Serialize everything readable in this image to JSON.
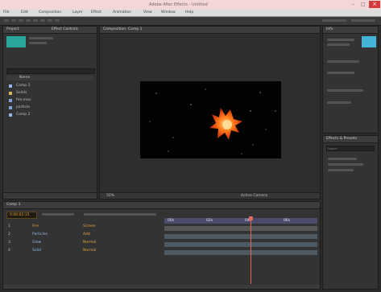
{
  "window": {
    "title": "Adobe After Effects - Untitled",
    "titlebar_color": "#f3d7d7"
  },
  "menu": [
    "File",
    "Edit",
    "Composition",
    "Layer",
    "Effect",
    "Animation",
    "View",
    "Window",
    "Help"
  ],
  "project": {
    "tab_label": "Project",
    "effects_tab_label": "Effect Controls",
    "thumbnail_color": "#2aa79a",
    "list_header": "Name",
    "items": [
      {
        "name": "Comp 1",
        "icon_color": "#8fb9e6"
      },
      {
        "name": "Solids",
        "icon_color": "#d7b35a"
      },
      {
        "name": "fire.mov",
        "icon_color": "#79a7d7"
      },
      {
        "name": "particle",
        "icon_color": "#79a7d7"
      },
      {
        "name": "Comp 2",
        "icon_color": "#8fb9e6"
      }
    ]
  },
  "composition": {
    "tab_label": "Composition: Comp 1",
    "zoom": "50%",
    "bottom_bar_label": "Active Camera"
  },
  "right_panel": {
    "top_tab": "Info",
    "info_color": "#44b3d8",
    "effects_tab": "Effects & Presets",
    "search_placeholder": "Search"
  },
  "timeline": {
    "tab_label": "Comp 1",
    "timecode": "0:00:02:15",
    "timecode_color": "#e3a53a",
    "ruler_labels": [
      "00s",
      "02s",
      "04s",
      "06s"
    ],
    "layers": [
      {
        "num": "1",
        "name": "Fire"
      },
      {
        "num": "2",
        "name": "Particles"
      },
      {
        "num": "3",
        "name": "Glow"
      },
      {
        "num": "4",
        "name": "Solid"
      }
    ],
    "playhead_color": "#e0685a"
  }
}
